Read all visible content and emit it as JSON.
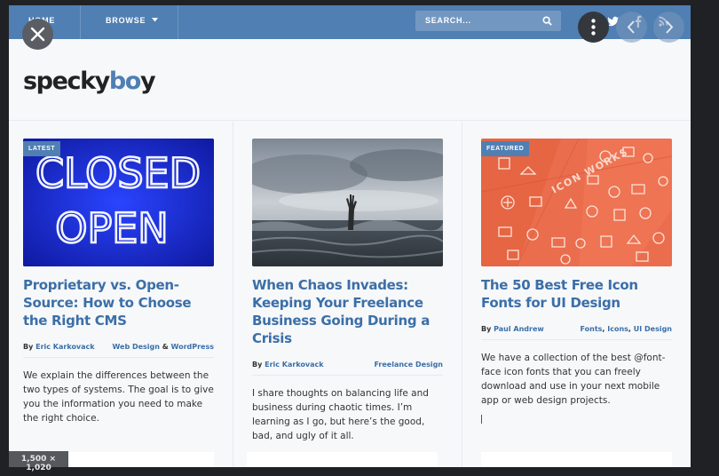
{
  "nav": {
    "home": "HOME",
    "browse": "BROWSE",
    "search_placeholder": "SEARCH...",
    "social_icons": [
      "twitter-icon",
      "facebook-icon",
      "rss-icon"
    ]
  },
  "logo": {
    "part1": "specky",
    "part2": "bo",
    "part3": "y"
  },
  "posts": [
    {
      "badge": "LATEST",
      "title": "Proprietary vs. Open-Source: How to Choose the Right CMS",
      "by": "By",
      "author": "Eric Karkovack",
      "cat1": "Web Design",
      "amp": "&",
      "cat2": "WordPress",
      "excerpt": "We explain the differences between the two types of systems. The goal is to give you the information you need to make the right choice.",
      "image_text_1": "CLOSED",
      "image_text_2": "OPEN"
    },
    {
      "badge": "",
      "title": "When Chaos Invades: Keeping Your Freelance Business Going During a Crisis",
      "by": "By",
      "author": "Eric Karkovack",
      "cat1": "Freelance Design",
      "excerpt": "I share thoughts on balancing life and business during chaotic times. I’m learning as I go, but here’s the good, bad, and ugly of it all."
    },
    {
      "badge": "FEATURED",
      "title": "The 50 Best Free Icon Fonts for UI Design",
      "by": "By",
      "author": "Paul Andrew",
      "cat1": "Fonts",
      "cat2": "Icons",
      "cat3": "UI Design",
      "sep": ", ",
      "excerpt": "We have a collection of the best @font-face icon fonts that you can freely download and use in your next mobile app or web design projects.",
      "image_text": "ICON WORKS"
    }
  ],
  "viewer": {
    "dimensions": "1,500 × 1,020",
    "close": "✕",
    "kebab": "⋮",
    "prev": "‹",
    "next": "›"
  },
  "colors": {
    "accent": "#4f7fb3",
    "title": "#3b6fa7",
    "nav": "#4f7fb3"
  }
}
